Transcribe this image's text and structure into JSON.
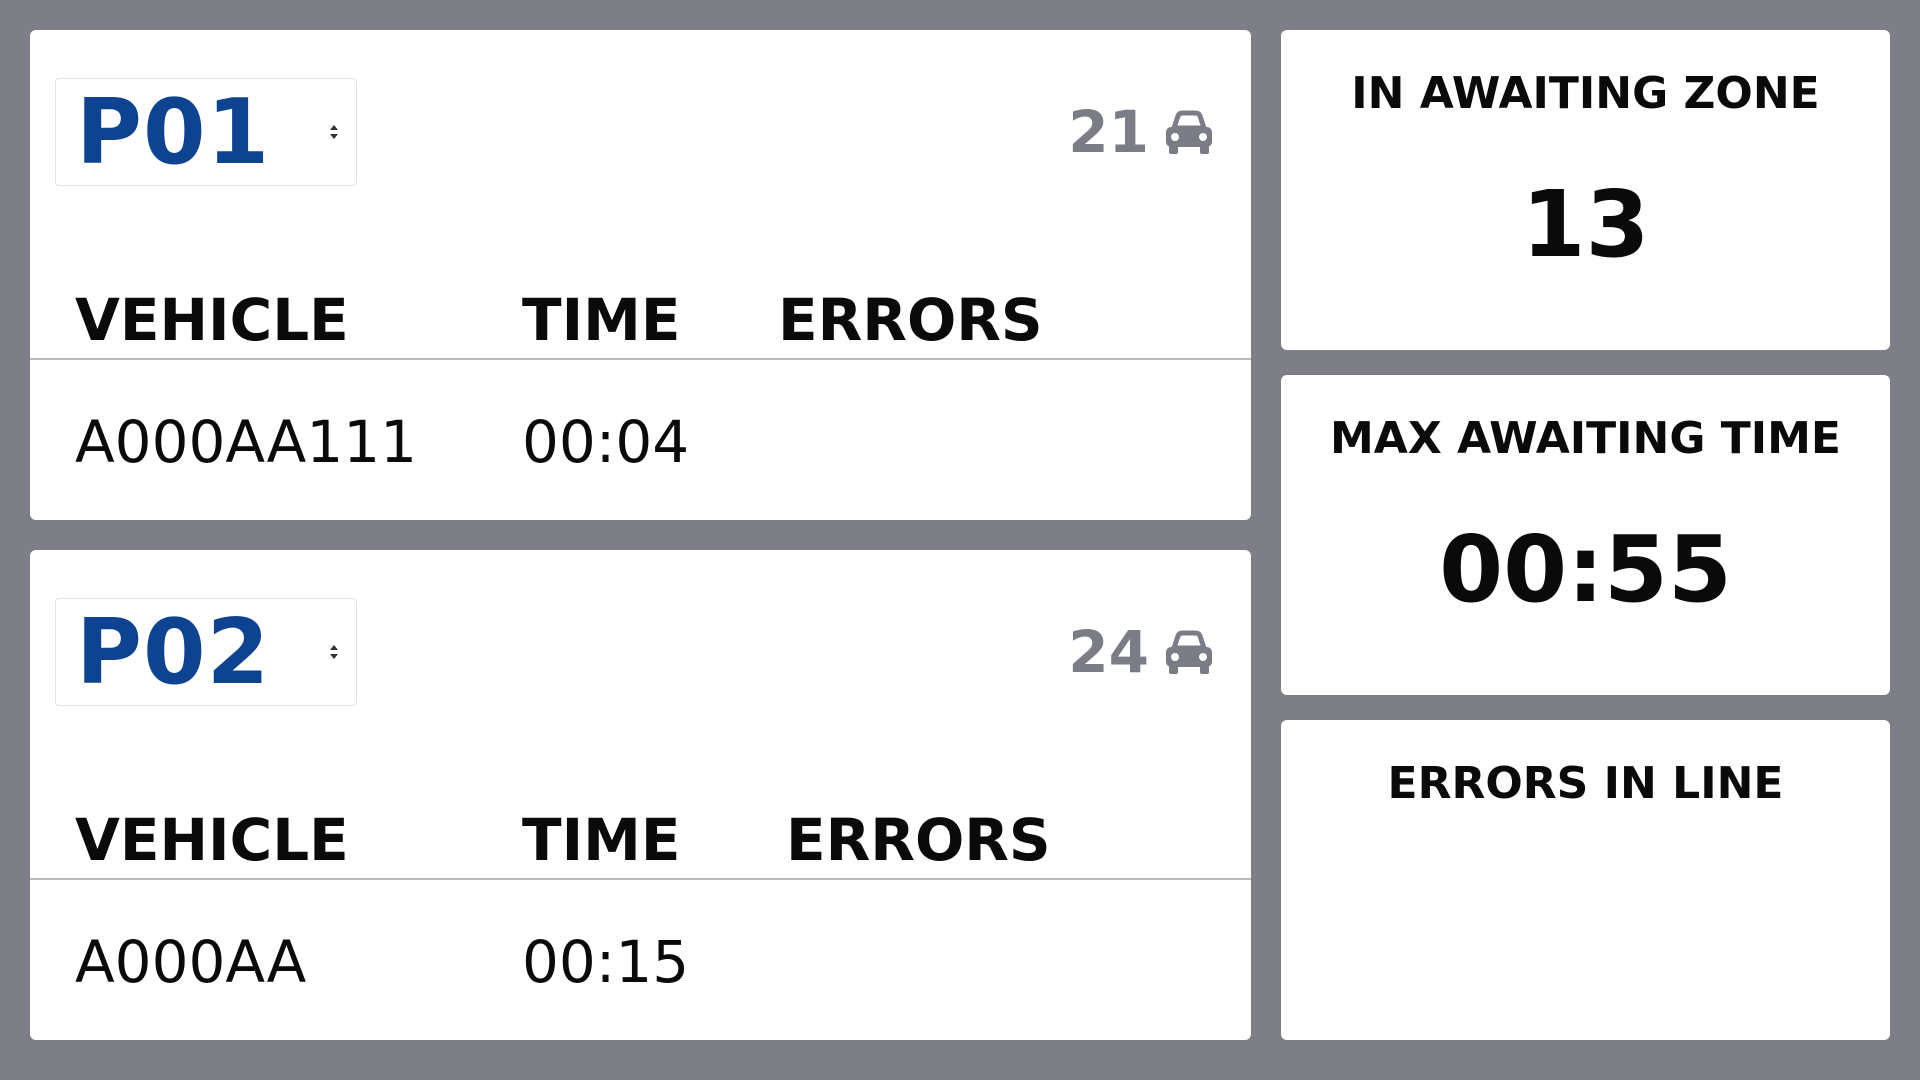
{
  "lanes": [
    {
      "lane": "P01",
      "vehicle_count": "21",
      "headers": {
        "vehicle": "VEHICLE",
        "time": "TIME",
        "errors": "ERRORS"
      },
      "rows": [
        {
          "vehicle": "A000AA111",
          "time": "00:04",
          "errors": ""
        }
      ]
    },
    {
      "lane": "P02",
      "vehicle_count": "24",
      "headers": {
        "vehicle": "VEHICLE",
        "time": "TIME",
        "errors": "ERRORS"
      },
      "rows": [
        {
          "vehicle": "A000AA",
          "time": "00:15",
          "errors": ""
        }
      ]
    }
  ],
  "stats": {
    "awaiting_zone": {
      "label": "IN AWAITING ZONE",
      "value": "13"
    },
    "max_awaiting_time": {
      "label": "MAX AWAITING TIME",
      "value": "00:55"
    },
    "errors_in_line": {
      "label": "ERRORS IN LINE",
      "value": ""
    }
  },
  "icons": {
    "vehicle_count": "car-icon",
    "lane_selector": "sort-arrows-icon"
  },
  "colors": {
    "background": "#7e7f86",
    "lane_accent": "#0d4390",
    "count_text": "#7a7d85"
  }
}
